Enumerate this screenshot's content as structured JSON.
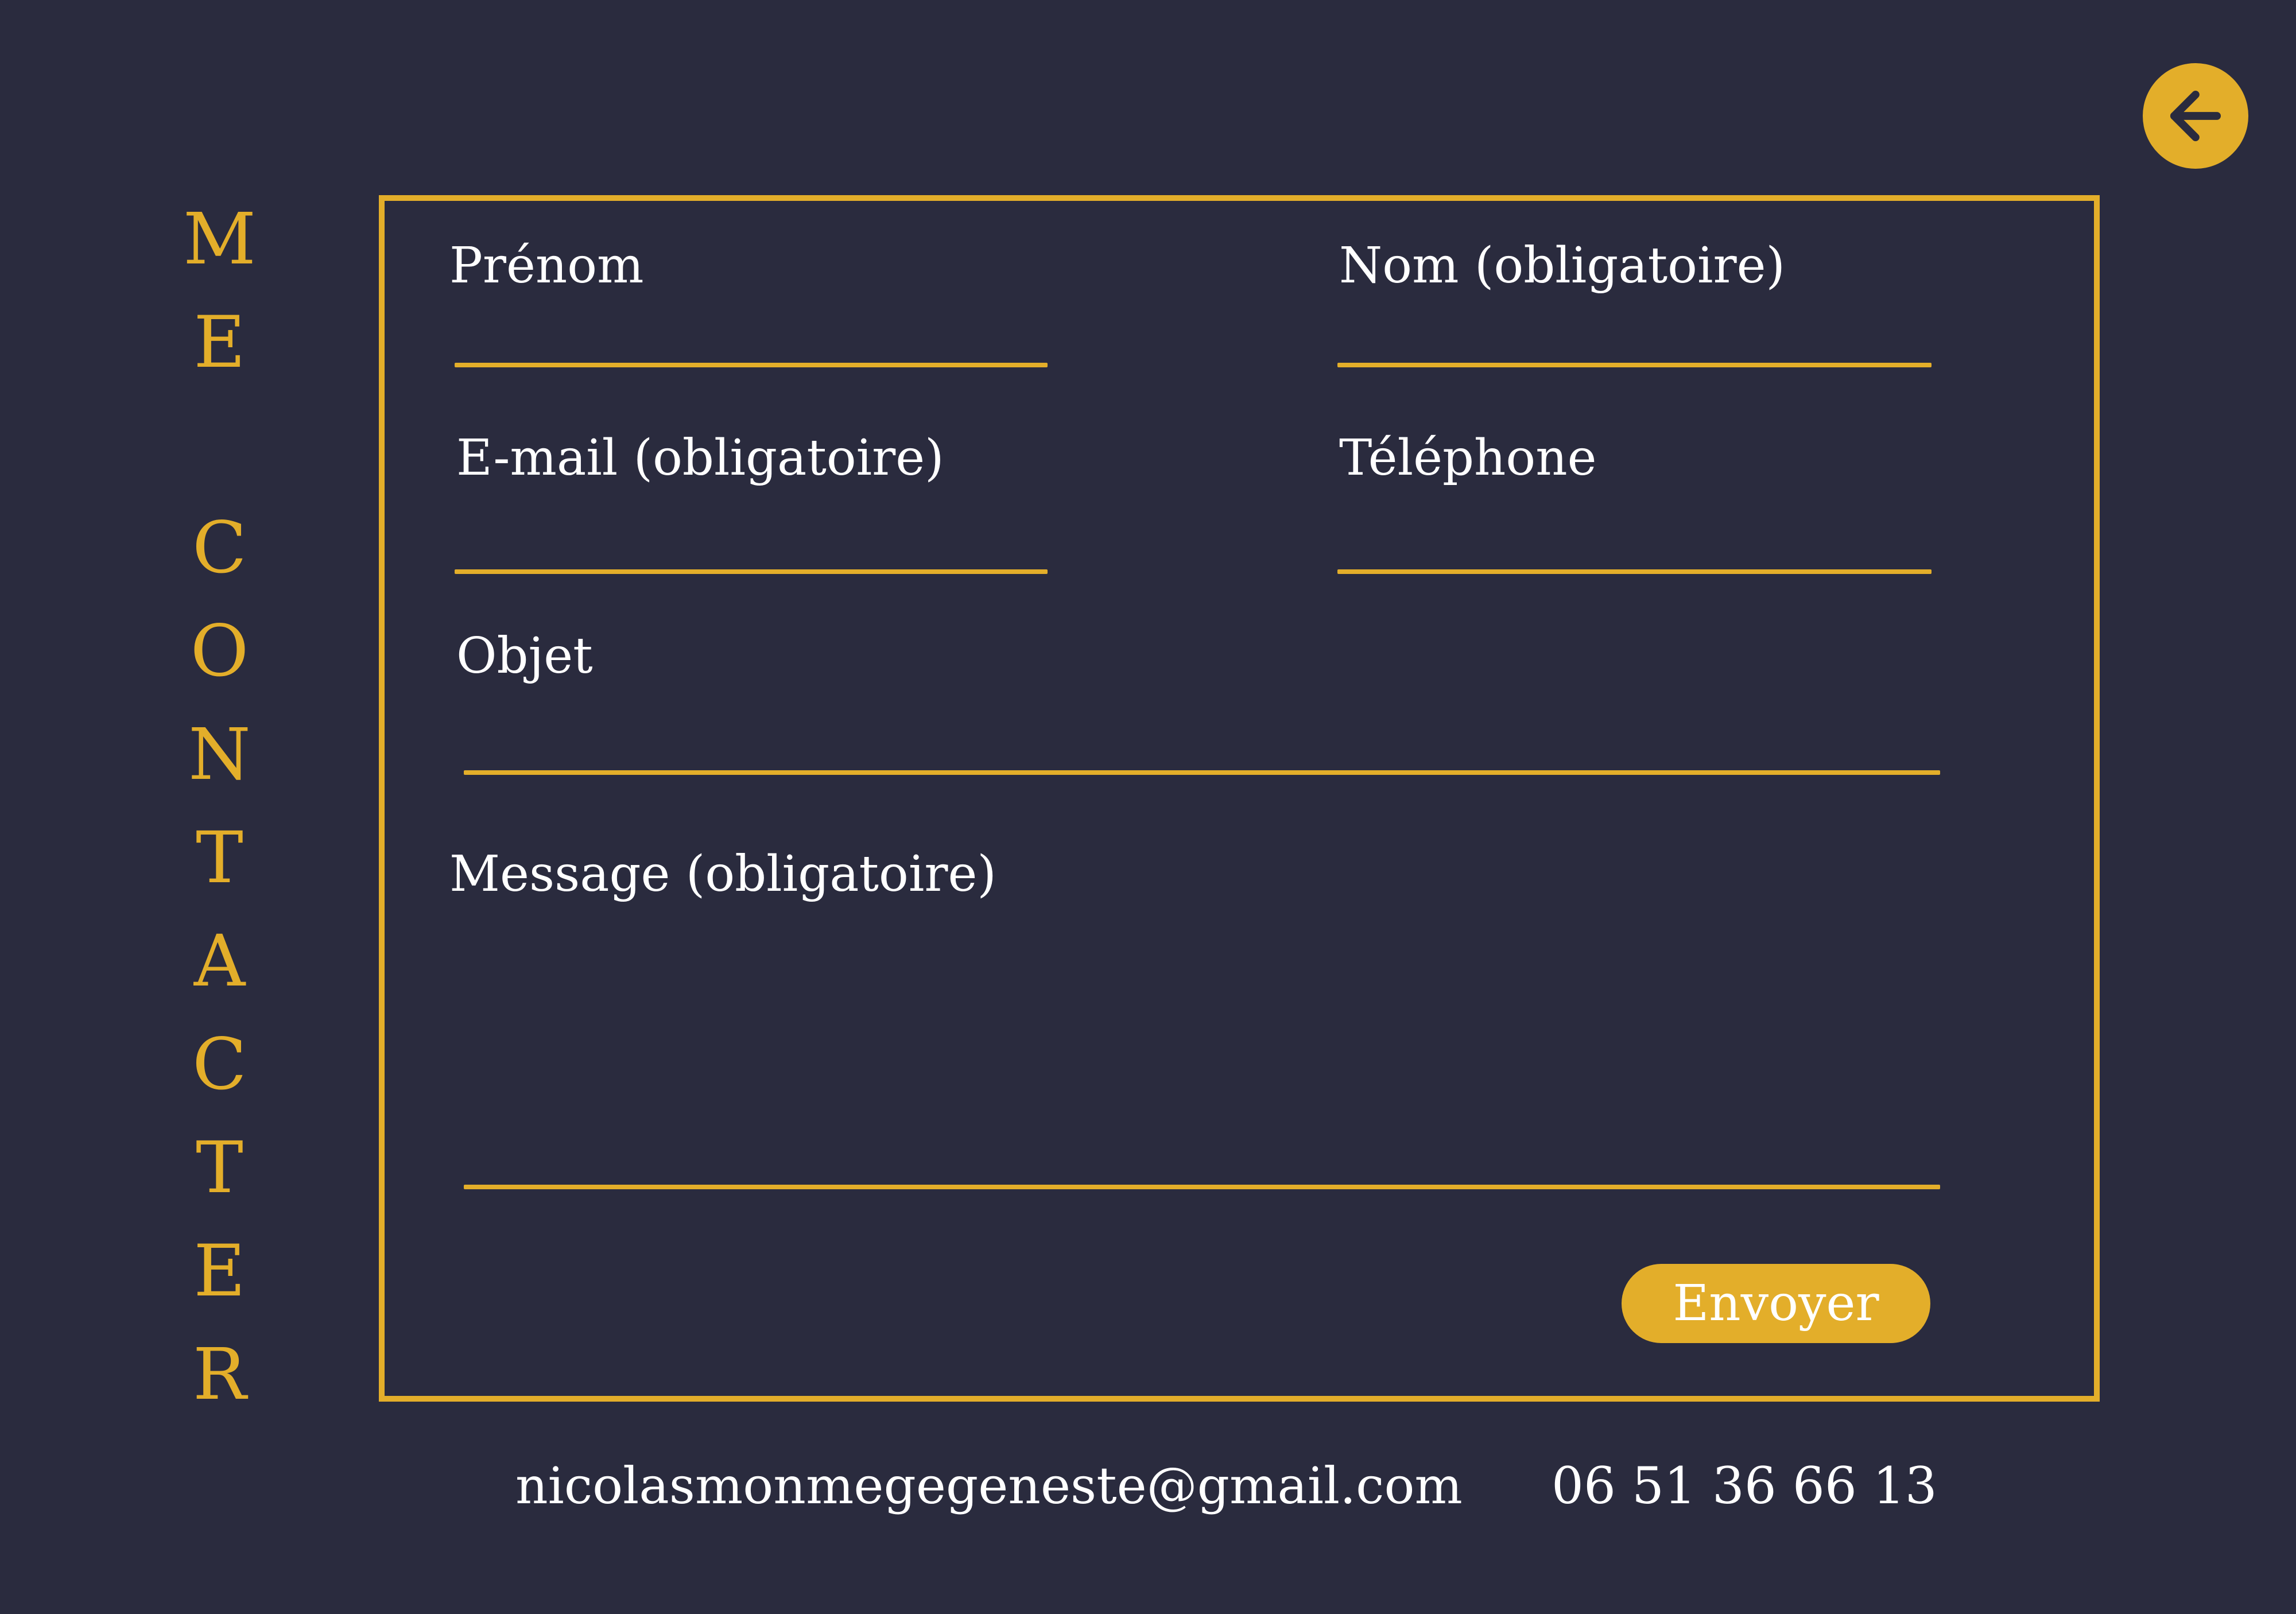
{
  "header": {
    "back_icon": "arrow-left-icon"
  },
  "sidebar": {
    "title_letters": [
      "M",
      "E",
      "C",
      "O",
      "N",
      "T",
      "A",
      "C",
      "T",
      "E",
      "R"
    ]
  },
  "form": {
    "fields": [
      {
        "label": "Prénom",
        "value": ""
      },
      {
        "label": "Nom (obligatoire)",
        "value": ""
      },
      {
        "label": "E-mail (obligatoire)",
        "value": ""
      },
      {
        "label": "Téléphone",
        "value": ""
      },
      {
        "label": "Objet",
        "value": ""
      },
      {
        "label": "Message (obligatoire)",
        "value": ""
      }
    ],
    "submit_label": "Envoyer"
  },
  "footer": {
    "email": "nicolasmonmegegeneste@gmail.com",
    "phone": "06 51 36 66 13"
  },
  "colors": {
    "background": "#2a2b3e",
    "accent": "#e3ae2a",
    "text": "#ffffff"
  }
}
